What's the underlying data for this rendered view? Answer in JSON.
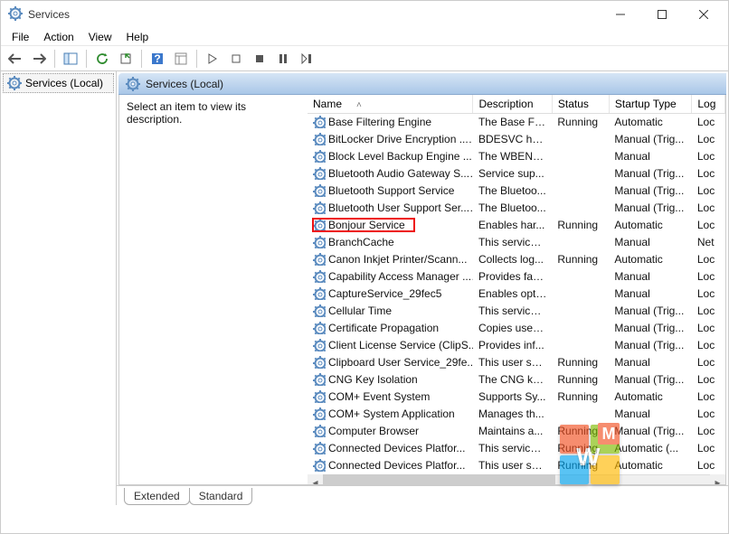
{
  "window": {
    "title": "Services"
  },
  "menu": {
    "file": "File",
    "action": "Action",
    "view": "View",
    "help": "Help"
  },
  "nav": {
    "servicesLocal": "Services (Local)"
  },
  "localHeader": "Services (Local)",
  "descPane": "Select an item to view its description.",
  "columns": {
    "name": "Name",
    "description": "Description",
    "status": "Status",
    "startup": "Startup Type",
    "logon": "Log"
  },
  "tabs": {
    "extended": "Extended",
    "standard": "Standard"
  },
  "highlightIndex": 6,
  "services": [
    {
      "name": "Base Filtering Engine",
      "desc": "The Base Fil...",
      "status": "Running",
      "startup": "Automatic",
      "logon": "Loc"
    },
    {
      "name": "BitLocker Drive Encryption ...",
      "desc": "BDESVC hos...",
      "status": "",
      "startup": "Manual (Trig...",
      "logon": "Loc"
    },
    {
      "name": "Block Level Backup Engine ...",
      "desc": "The WBENG...",
      "status": "",
      "startup": "Manual",
      "logon": "Loc"
    },
    {
      "name": "Bluetooth Audio Gateway S...",
      "desc": "Service sup...",
      "status": "",
      "startup": "Manual (Trig...",
      "logon": "Loc"
    },
    {
      "name": "Bluetooth Support Service",
      "desc": "The Bluetoo...",
      "status": "",
      "startup": "Manual (Trig...",
      "logon": "Loc"
    },
    {
      "name": "Bluetooth User Support Ser...",
      "desc": "The Bluetoo...",
      "status": "",
      "startup": "Manual (Trig...",
      "logon": "Loc"
    },
    {
      "name": "Bonjour Service",
      "desc": "Enables har...",
      "status": "Running",
      "startup": "Automatic",
      "logon": "Loc"
    },
    {
      "name": "BranchCache",
      "desc": "This service ...",
      "status": "",
      "startup": "Manual",
      "logon": "Net"
    },
    {
      "name": "Canon Inkjet Printer/Scann...",
      "desc": "Collects log...",
      "status": "Running",
      "startup": "Automatic",
      "logon": "Loc"
    },
    {
      "name": "Capability Access Manager ...",
      "desc": "Provides fac...",
      "status": "",
      "startup": "Manual",
      "logon": "Loc"
    },
    {
      "name": "CaptureService_29fec5",
      "desc": "Enables opti...",
      "status": "",
      "startup": "Manual",
      "logon": "Loc"
    },
    {
      "name": "Cellular Time",
      "desc": "This service ...",
      "status": "",
      "startup": "Manual (Trig...",
      "logon": "Loc"
    },
    {
      "name": "Certificate Propagation",
      "desc": "Copies user ...",
      "status": "",
      "startup": "Manual (Trig...",
      "logon": "Loc"
    },
    {
      "name": "Client License Service (ClipS...",
      "desc": "Provides inf...",
      "status": "",
      "startup": "Manual (Trig...",
      "logon": "Loc"
    },
    {
      "name": "Clipboard User Service_29fe...",
      "desc": "This user ser...",
      "status": "Running",
      "startup": "Manual",
      "logon": "Loc"
    },
    {
      "name": "CNG Key Isolation",
      "desc": "The CNG ke...",
      "status": "Running",
      "startup": "Manual (Trig...",
      "logon": "Loc"
    },
    {
      "name": "COM+ Event System",
      "desc": "Supports Sy...",
      "status": "Running",
      "startup": "Automatic",
      "logon": "Loc"
    },
    {
      "name": "COM+ System Application",
      "desc": "Manages th...",
      "status": "",
      "startup": "Manual",
      "logon": "Loc"
    },
    {
      "name": "Computer Browser",
      "desc": "Maintains a...",
      "status": "Running",
      "startup": "Manual (Trig...",
      "logon": "Loc"
    },
    {
      "name": "Connected Devices Platfor...",
      "desc": "This service ...",
      "status": "Running",
      "startup": "Automatic (...",
      "logon": "Loc"
    },
    {
      "name": "Connected Devices Platfor...",
      "desc": "This user ser...",
      "status": "Running",
      "startup": "Automatic",
      "logon": "Loc"
    }
  ]
}
